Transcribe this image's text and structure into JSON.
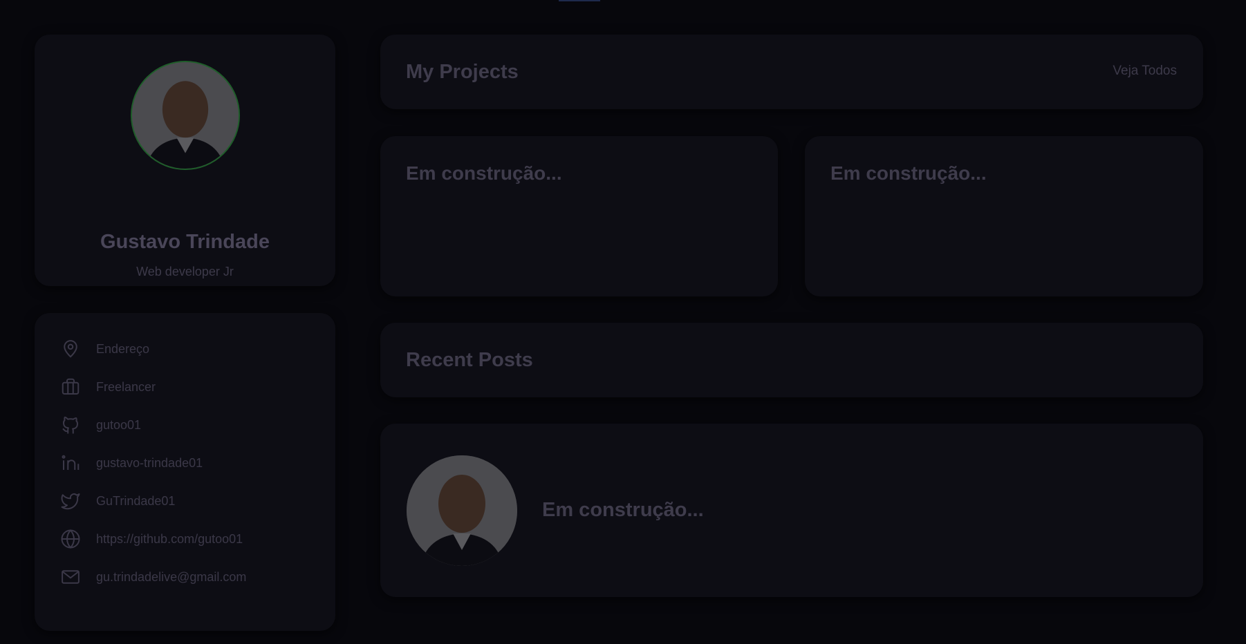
{
  "profile": {
    "name": "Gustavo Trindade",
    "role": "Web developer Jr",
    "avatar_icon": "person-photo"
  },
  "info": {
    "items": [
      {
        "icon": "map-pin-icon",
        "text": "Endereço"
      },
      {
        "icon": "briefcase-icon",
        "text": "Freelancer"
      },
      {
        "icon": "github-icon",
        "text": "gutoo01"
      },
      {
        "icon": "linkedin-icon",
        "text": "gustavo-trindade01"
      },
      {
        "icon": "twitter-icon",
        "text": "GuTrindade01"
      },
      {
        "icon": "globe-icon",
        "text": "https://github.com/gutoo01"
      },
      {
        "icon": "mail-icon",
        "text": "gu.trindadelive@gmail.com"
      }
    ]
  },
  "projects": {
    "title": "My Projects",
    "see_all_label": "Veja Todos",
    "cards": [
      {
        "title": "Em construção..."
      },
      {
        "title": "Em construção..."
      }
    ]
  },
  "posts": {
    "title": "Recent Posts",
    "items": [
      {
        "title": "Em construção..."
      }
    ]
  },
  "colors": {
    "background": "#07070c",
    "card": "#0d0d14",
    "avatar_border": "#1f5e2a",
    "text_muted": "#3b3848"
  }
}
